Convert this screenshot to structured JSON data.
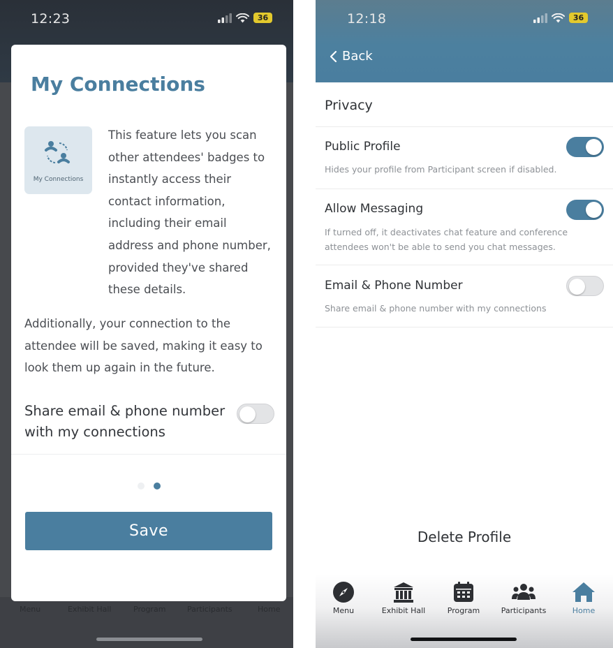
{
  "left_screen": {
    "status": {
      "time": "12:23",
      "battery": "36"
    },
    "modal": {
      "title": "My Connections",
      "feature_tile_label": "My Connections",
      "description_lines": [
        "This feature lets you scan",
        "other attendees' badges to",
        "instantly access their",
        "contact information,",
        "including their email",
        "address and phone number,",
        "provided they've shared",
        "these details."
      ],
      "additional_lines": [
        "Additionally, your connection to the",
        "attendee will be saved, making it easy to",
        "look them up again in the future."
      ],
      "share_label_lines": [
        "Share email & phone number",
        "with my connections"
      ],
      "share_toggle_on": false,
      "pager": {
        "count": 2,
        "active_index": 1
      },
      "save_label": "Save"
    },
    "background_tabs": [
      "Menu",
      "Exhibit Hall",
      "Program",
      "Participants",
      "Home"
    ]
  },
  "right_screen": {
    "status": {
      "time": "12:18",
      "battery": "36"
    },
    "header": {
      "back_label": "Back"
    },
    "section_title": "Privacy",
    "settings": [
      {
        "label": "Public Profile",
        "description_lines": [
          "Hides your profile from Participant screen if disabled."
        ],
        "enabled": true
      },
      {
        "label": "Allow Messaging",
        "description_lines": [
          "If turned off, it deactivates chat feature and conference",
          "attendees won't be able to send you chat messages."
        ],
        "enabled": true
      },
      {
        "label": "Email & Phone Number",
        "description_lines": [
          "Share email & phone number with my connections"
        ],
        "enabled": false
      }
    ],
    "delete_label": "Delete Profile",
    "tabbar": [
      {
        "label": "Menu",
        "icon": "compass-icon",
        "active": false
      },
      {
        "label": "Exhibit Hall",
        "icon": "building-icon",
        "active": false
      },
      {
        "label": "Program",
        "icon": "calendar-icon",
        "active": false
      },
      {
        "label": "Participants",
        "icon": "people-icon",
        "active": false
      },
      {
        "label": "Home",
        "icon": "home-icon",
        "active": true
      }
    ]
  },
  "colors": {
    "accent": "#4a7e9f",
    "toggle_off": "#e3e4e6",
    "text_primary": "#2f3236",
    "text_secondary": "#8d9196"
  }
}
